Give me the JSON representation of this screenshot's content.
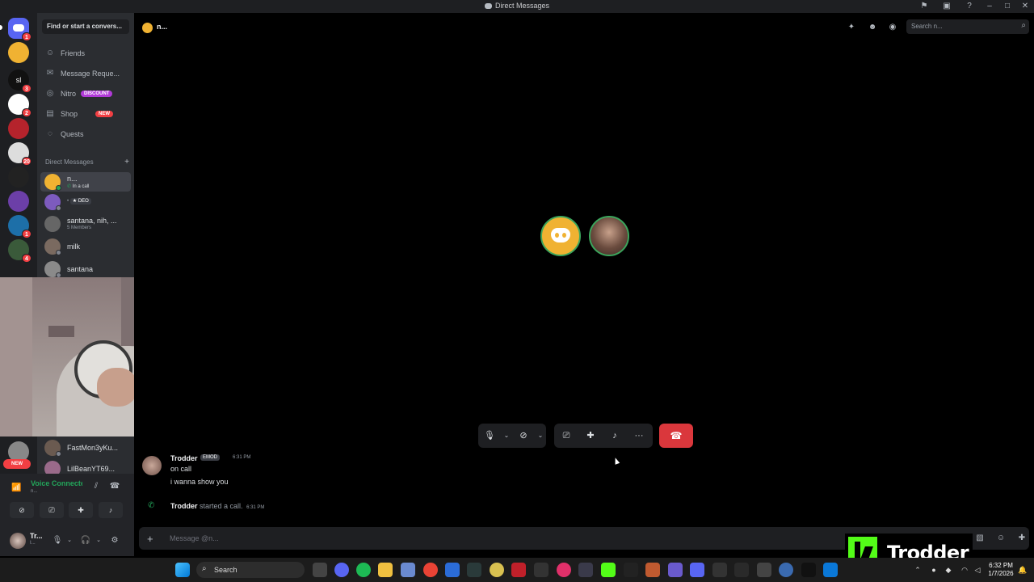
{
  "window": {
    "title": "Direct Messages"
  },
  "sidebar": {
    "find_placeholder": "Find or start a convers...",
    "nav": [
      {
        "label": "Friends",
        "icon": "friends-icon"
      },
      {
        "label": "Message Reque...",
        "icon": "envelope-icon"
      },
      {
        "label": "Nitro",
        "icon": "nitro-icon",
        "tag": "DISCOUNT"
      },
      {
        "label": "Shop",
        "icon": "shop-icon",
        "tag": "NEW"
      },
      {
        "label": "Quests",
        "icon": "quests-icon"
      }
    ],
    "dm_header": "Direct Messages",
    "dms": [
      {
        "name": "n...",
        "sub": "In a call",
        "active": true
      },
      {
        "name": "",
        "sub": "",
        "badge": "DEO"
      },
      {
        "name": "santana, nih, ...",
        "sub": "5 Members"
      },
      {
        "name": "milk",
        "sub": ""
      },
      {
        "name": "santana",
        "sub": ""
      },
      {
        "name": "FastMon3yKu...",
        "sub": ""
      },
      {
        "name": "LilBeanYT69...",
        "sub": ""
      }
    ]
  },
  "guilds": {
    "badges": [
      "1",
      "3",
      "2",
      "20",
      "1",
      "4"
    ],
    "server_sl_label": "sl",
    "new_label": "NEW"
  },
  "channel": {
    "name": "n..."
  },
  "search": {
    "placeholder": "Search n..."
  },
  "messages": [
    {
      "author": "Trodder",
      "badge": "EMOD",
      "time": "6:31 PM",
      "lines": [
        "on call",
        "i wanna show you"
      ]
    }
  ],
  "system_message": {
    "author": "Trodder",
    "text": "started a call.",
    "time": "6:31 PM"
  },
  "composer": {
    "placeholder": "Message @n..."
  },
  "voice": {
    "title": "Voice Connected",
    "sub": "n..."
  },
  "user": {
    "name": "Tr...",
    "sub": "I..."
  },
  "watermark": {
    "text": "Trodder"
  },
  "taskbar": {
    "search_label": "Search",
    "time": "6:32 PM",
    "date": "1/7/2026"
  },
  "colors": {
    "accent": "#5865f2",
    "green": "#23a55a",
    "danger": "#da373c",
    "kick": "#53fc18"
  }
}
